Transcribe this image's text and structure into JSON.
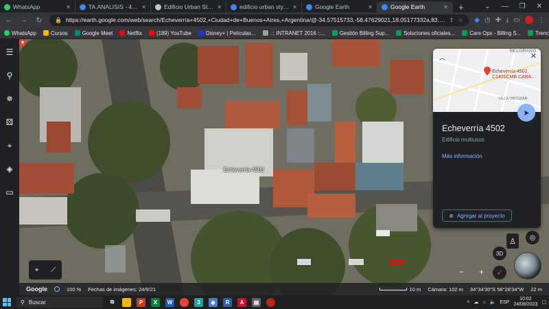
{
  "browser": {
    "tabs": [
      {
        "label": "WhatsApp",
        "color": "#25d366"
      },
      {
        "label": "TA.ANALISIS - 42 × 29.7 cm",
        "color": "#4285f4"
      },
      {
        "label": "Edificio Urban Style 2 / F2M",
        "color": "#bdc1c6"
      },
      {
        "label": "edificio urban style 2 - Busc",
        "color": "#4285f4"
      },
      {
        "label": "Google Earth",
        "color": "#4285f4"
      },
      {
        "label": "Google Earth",
        "color": "#4285f4",
        "active": true
      }
    ],
    "new_tab": "+",
    "url": "https://earth.google.com/web/search/Echeverría+4502,+Ciudad+de+Buenos+Aires,+Argentina/@-34.57515733,-58.47629021,18.05177332a,83.91097549d,35y,146...",
    "bookmarks": [
      {
        "label": "WhatsApp",
        "color": "#25d366"
      },
      {
        "label": "Cursos",
        "color": "#fbbc04"
      },
      {
        "label": "Google Meet",
        "color": "#00897b"
      },
      {
        "label": "Netflix",
        "color": "#e50914"
      },
      {
        "label": "(189) YouTube",
        "color": "#ff0000"
      },
      {
        "label": "Disney+ | Películas...",
        "color": "#113ccf"
      },
      {
        "label": ".:: INTRANET 2016 ::...",
        "color": "#9aa0a6"
      },
      {
        "label": "Gestión Billing Sup...",
        "color": "#0f9d58"
      },
      {
        "label": "Soluciones oficiales...",
        "color": "#0f9d58"
      },
      {
        "label": "Care Ops - Billing S...",
        "color": "#0f9d58"
      },
      {
        "label": "Trencito - Google S...",
        "color": "#0f9d58"
      }
    ]
  },
  "map": {
    "place_label": "Echeverría 4502"
  },
  "card": {
    "area_top": "BELGRANO",
    "area_bottom": "VILLA ORTÚZAR",
    "map_address": "Echeverría 4502, C1431CMB CABA...",
    "title": "Echeverría 4502",
    "subtitle": "Edificio multiusos",
    "more_info": "Más información",
    "add_to_project": "Agregar al proyecto"
  },
  "controls": {
    "three_d": "3D",
    "zoom_in": "+",
    "zoom_out": "−"
  },
  "status": {
    "brand": "Google",
    "zoom_percent": "100 %",
    "imagery_date": "Fechas de imágenes: 24/9/21",
    "scale": "10 m",
    "camera": "Cámara: 102 m",
    "coords": "34°34'30\"S 58°28'34\"W",
    "elevation": "22 m"
  },
  "taskbar": {
    "search_placeholder": "Buscar",
    "lang": "ESP",
    "time": "10:02",
    "date": "24/08/2023"
  }
}
